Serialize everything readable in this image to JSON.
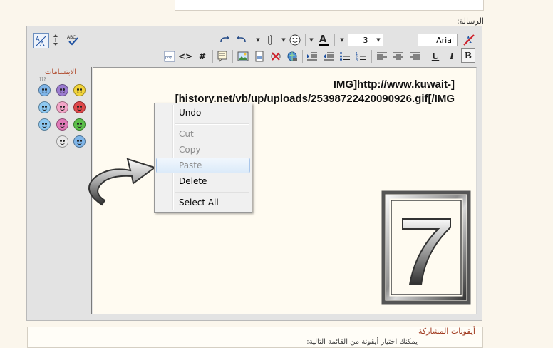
{
  "form": {
    "message_label": "الرسالة:",
    "post_icons_title": "أيقونات المشاركة",
    "post_icons_subtitle": "يمكنك اختيار أيقونة من القائمة التالية:"
  },
  "toolbar": {
    "font_name": "Arial",
    "font_size": "3",
    "bold_label": "B",
    "italic_label": "I",
    "underline_label": "U",
    "hash_label": "#",
    "code_label": "<>",
    "php_label": "php",
    "spell_label": "ABC"
  },
  "smilies": {
    "title": "الابتسامات",
    "more": "???",
    "items": [
      {
        "name": "smile",
        "color": "#f2d43a"
      },
      {
        "name": "purple",
        "color": "#9b7bd0"
      },
      {
        "name": "confused",
        "color": "#7fb5e8"
      },
      {
        "name": "angry",
        "color": "#e0484a"
      },
      {
        "name": "tongue",
        "color": "#f3a6c8"
      },
      {
        "name": "wink",
        "color": "#8ec8f0"
      },
      {
        "name": "grin",
        "color": "#5cbf4a"
      },
      {
        "name": "redface",
        "color": "#e07ab8"
      },
      {
        "name": "cool",
        "color": "#f2d43a"
      },
      {
        "name": "eek",
        "color": "#e8e8e8"
      }
    ]
  },
  "editor": {
    "line1": "IMG]http://www.kuwait-]",
    "line2": "[history.net/vb/up/uploads/25398722420090926.gif[/IMG"
  },
  "context_menu": {
    "undo": "Undo",
    "cut": "Cut",
    "copy": "Copy",
    "paste": "Paste",
    "delete": "Delete",
    "select_all": "Select All"
  },
  "tile": {
    "number": "7"
  },
  "colors": {
    "accent_red": "#a0391e",
    "menu_hover_border": "#a9c6ea",
    "editor_bg": "#fffbf1"
  }
}
